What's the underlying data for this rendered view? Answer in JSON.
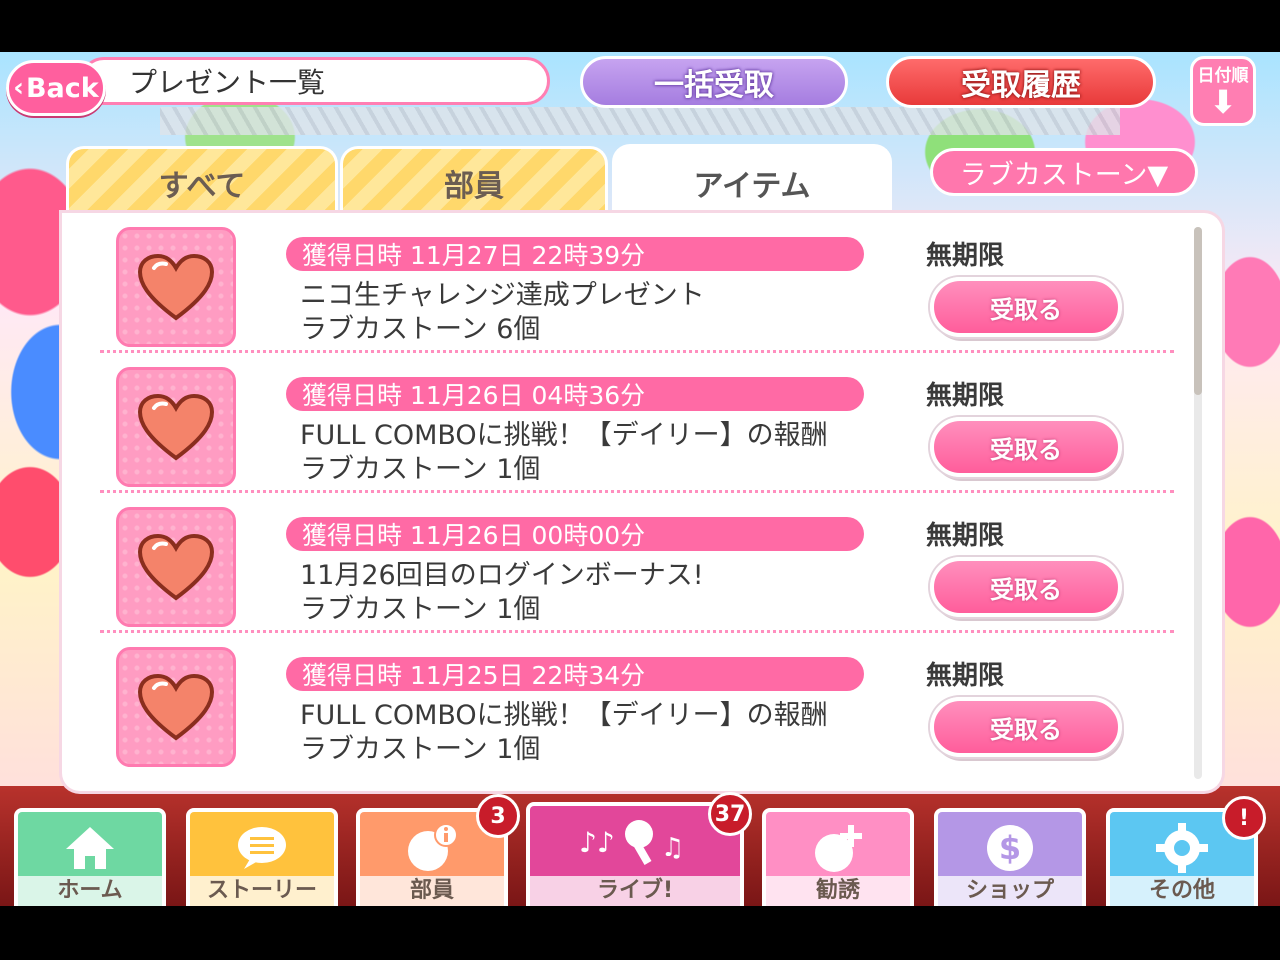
{
  "header": {
    "back_label": "Back",
    "title": "プレゼント一覧",
    "bulk_receive_label": "一括受取",
    "history_label": "受取履歴",
    "sort_label": "日付順"
  },
  "tabs": [
    {
      "label": "すべて",
      "active": false
    },
    {
      "label": "部員",
      "active": false
    },
    {
      "label": "アイテム",
      "active": true
    }
  ],
  "filter": {
    "label": "ラブカストーン▼"
  },
  "presents": [
    {
      "date": "獲得日時 11月27日 22時39分",
      "title": "ニコ生チャレンジ達成プレゼント",
      "item": "ラブカストーン 6個",
      "expiry": "無期限",
      "button": "受取る"
    },
    {
      "date": "獲得日時 11月26日 04時36分",
      "title": "FULL COMBOに挑戦！【デイリー】の報酬",
      "item": "ラブカストーン 1個",
      "expiry": "無期限",
      "button": "受取る"
    },
    {
      "date": "獲得日時 11月26日 00時00分",
      "title": "11月26回目のログインボーナス!",
      "item": "ラブカストーン 1個",
      "expiry": "無期限",
      "button": "受取る"
    },
    {
      "date": "獲得日時 11月25日 22時34分",
      "title": "FULL COMBOに挑戦！【デイリー】の報酬",
      "item": "ラブカストーン 1個",
      "expiry": "無期限",
      "button": "受取る"
    }
  ],
  "nav": {
    "home": "ホーム",
    "story": "ストーリー",
    "members": "部員",
    "members_badge": "3",
    "live": "ライブ!",
    "live_badge": "37",
    "scout": "勧誘",
    "shop": "ショップ",
    "other": "その他",
    "other_badge": "!"
  },
  "colors": {
    "accent_pink": "#ff6aa5",
    "bulk_purple": "#a57de0",
    "history_red": "#e83a3a",
    "tab_yellow": "#ffd86b"
  },
  "icons": {
    "item_icon": "heart-icon",
    "sort_icon": "arrow-down-icon"
  }
}
